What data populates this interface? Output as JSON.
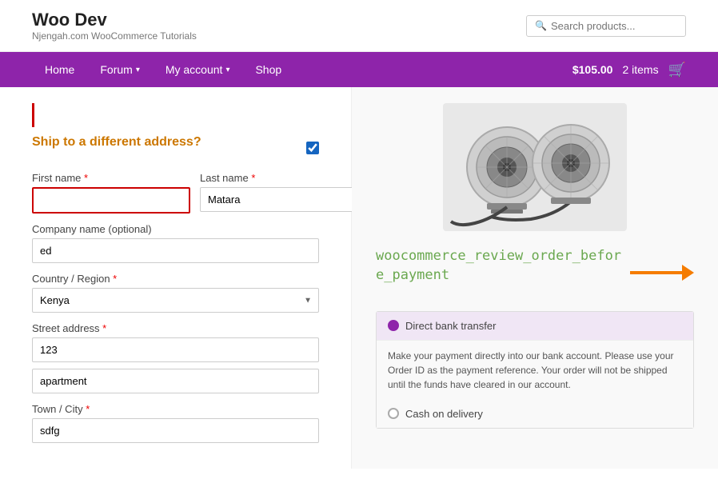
{
  "site": {
    "title": "Woo Dev",
    "tagline": "Njengah.com WooCommerce Tutorials"
  },
  "search": {
    "placeholder": "Search products..."
  },
  "nav": {
    "items": [
      {
        "label": "Home",
        "hasDropdown": false
      },
      {
        "label": "Forum",
        "hasDropdown": true
      },
      {
        "label": "My account",
        "hasDropdown": true
      },
      {
        "label": "Shop",
        "hasDropdown": false
      }
    ],
    "cart_amount": "$105.00",
    "cart_items": "2 items"
  },
  "form": {
    "top_line": "",
    "ship_title": "Ship to a different address?",
    "first_name_label": "First name",
    "last_name_label": "Last name",
    "last_name_value": "Matara",
    "company_label": "Company name (optional)",
    "company_value": "ed",
    "country_label": "Country / Region",
    "country_value": "Kenya",
    "street_label": "Street address",
    "street_value": "123",
    "apt_value": "apartment",
    "city_label": "Town / City",
    "city_value": "sdfg",
    "required_marker": "*"
  },
  "right": {
    "hook_text": "woocommerce_review_order_before_payment",
    "payment_title_1": "Direct bank transfer",
    "payment_title_2": "Cash on delivery",
    "payment_description": "Make your payment directly into our bank account. Please use your Order ID as the payment reference. Your order will not be shipped until the funds have cleared in our account."
  }
}
